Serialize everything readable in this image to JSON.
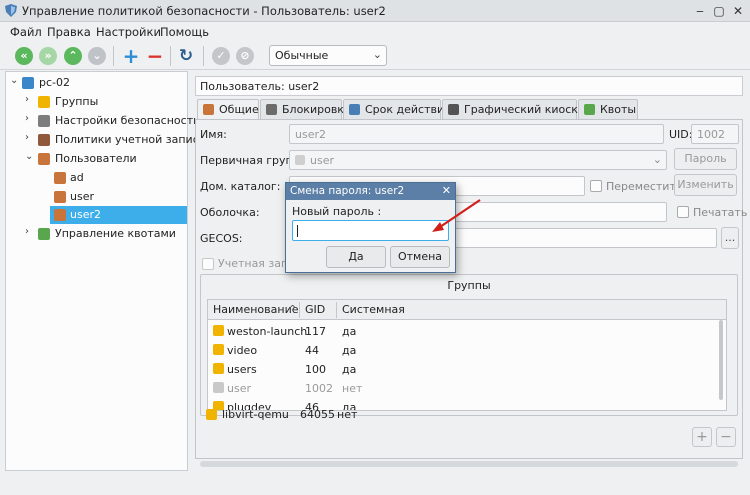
{
  "window": {
    "title": "Управление политикой безопасности - Пользователь: user2",
    "min": "‒",
    "max": "▢",
    "close": "✕"
  },
  "menu": [
    "Файл",
    "Правка",
    "Настройки",
    "Помощь"
  ],
  "toolbar": {
    "mode_select": "Обычные"
  },
  "tree": {
    "root": "pc-02",
    "items": [
      {
        "label": "Группы"
      },
      {
        "label": "Настройки безопасности"
      },
      {
        "label": "Политики учетной записи"
      },
      {
        "label": "Пользователи"
      },
      {
        "label": "ad"
      },
      {
        "label": "user"
      },
      {
        "label": "user2"
      },
      {
        "label": "Управление квотами"
      }
    ]
  },
  "header": {
    "user_title": "Пользователь: user2"
  },
  "tabs": [
    "Общие",
    "Блокировка",
    "Срок действия",
    "Графический киоск Fly",
    "Квоты"
  ],
  "form": {
    "name_label": "Имя:",
    "name_value": "user2",
    "uid_label": "UID:",
    "uid_value": "1002",
    "group_label": "Первичная группа:",
    "group_value": "user",
    "password_button": "Пароль",
    "home_label": "Дом. каталог:",
    "move_label": "Переместить",
    "change_button": "Изменить",
    "shell_label": "Оболочка:",
    "print_label": "Печатать",
    "gecos_label": "GECOS:",
    "gecos_button": "...",
    "account_label": "Учетная запис"
  },
  "groups": {
    "title": "Группы",
    "columns": [
      "Наименование",
      "GID",
      "Системная"
    ],
    "sort_arrow": "^",
    "rows": [
      {
        "name": "weston-launch",
        "gid": "117",
        "sys": "да"
      },
      {
        "name": "video",
        "gid": "44",
        "sys": "да"
      },
      {
        "name": "users",
        "gid": "100",
        "sys": "да"
      },
      {
        "name": "user",
        "gid": "1002",
        "sys": "нет"
      },
      {
        "name": "plugdev",
        "gid": "46",
        "sys": "да"
      },
      {
        "name": "libvirt-qemu",
        "gid": "64055",
        "sys": "нет"
      }
    ],
    "add": "+",
    "remove": "−"
  },
  "dialog": {
    "title": "Смена пароля: user2",
    "close": "✕",
    "label": "Новый пароль :",
    "ok": "Да",
    "cancel": "Отмена"
  },
  "colors": {
    "accent": "#3daee9",
    "dialog_title": "#5b7fa6",
    "arrow": "#d0201a"
  }
}
